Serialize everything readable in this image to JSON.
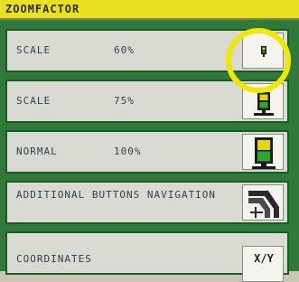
{
  "window": {
    "title": "ZOOMFACTOR"
  },
  "rows": [
    {
      "label": "SCALE",
      "value": "60%",
      "button_icon": "traffic-light-small-icon"
    },
    {
      "label": "SCALE",
      "value": "75%",
      "button_icon": "traffic-light-medium-icon"
    },
    {
      "label": "NORMAL",
      "value": "100%",
      "button_icon": "traffic-light-large-icon"
    },
    {
      "label": "ADDITIONAL BUTTONS NAVIGATION",
      "value": "",
      "button_icon": "navigation-icon"
    },
    {
      "label": "COORDINATES",
      "value": "",
      "button_label": "X/Y"
    }
  ],
  "colors": {
    "title_bar": "#e8e020",
    "panel_green": "#2f7a3a",
    "highlight_ring": "#f1e800"
  }
}
